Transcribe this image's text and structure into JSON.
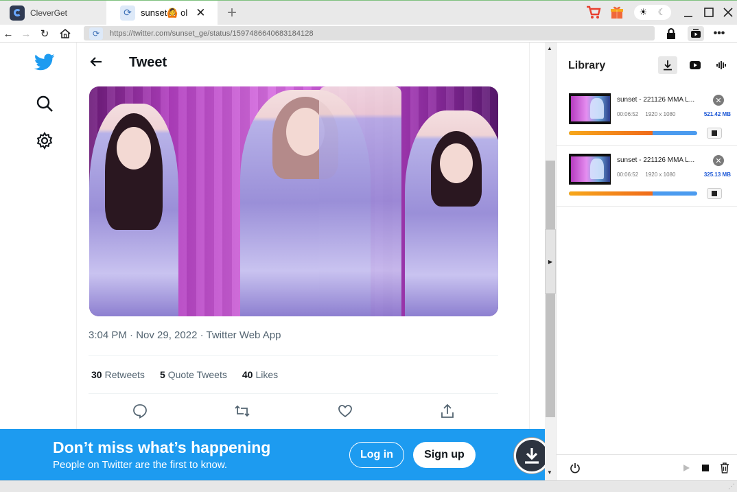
{
  "browser": {
    "app_tab_label": "CleverGet",
    "active_tab_label": "sunset🙆 ol",
    "new_tab_symbol": "+",
    "url": "https://twitter.com/sunset_ge/status/1597486640683184128"
  },
  "twitter": {
    "heading": "Tweet",
    "timestamp": "3:04 PM · Nov 29, 2022 · Twitter Web App",
    "stats": [
      {
        "count": "30",
        "label": "Retweets"
      },
      {
        "count": "5",
        "label": "Quote Tweets"
      },
      {
        "count": "40",
        "label": "Likes"
      }
    ],
    "banner": {
      "title": "Don’t miss what’s happening",
      "subtitle": "People on Twitter are the first to know.",
      "login_label": "Log in",
      "signup_label": "Sign up"
    },
    "brand_color": "#1d9bf0"
  },
  "library": {
    "title": "Library",
    "items": [
      {
        "name": "sunset - 221126 MMA  L...",
        "duration": "00:06:52",
        "resolution": "1920 x 1080",
        "size": "521.42 MB",
        "progress": 0.65
      },
      {
        "name": "sunset - 221126 MMA  L...",
        "duration": "00:06:52",
        "resolution": "1920 x 1080",
        "size": "325.13 MB",
        "progress": 0.65
      }
    ]
  },
  "icons": {
    "cart": "cart-icon",
    "gift": "gift-icon",
    "sun": "sun-icon",
    "moon": "moon-icon"
  }
}
